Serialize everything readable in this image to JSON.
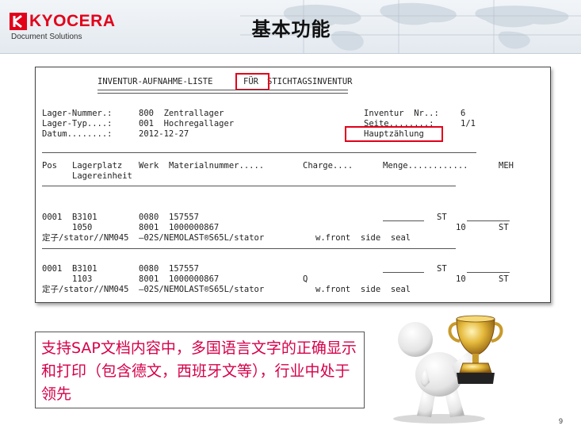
{
  "brand": {
    "name": "KYOCERA",
    "subtitle": "Document Solutions",
    "accent_color": "#e2001a"
  },
  "slide": {
    "title": "基本功能",
    "page_number": "9"
  },
  "printout": {
    "heading_left": "INVENTUR-AUFNAHME-LISTE",
    "heading_fur": "FÜR",
    "heading_right": "STICHTAGSINVENTUR",
    "lager_nummer_label": "Lager-Nummer.:",
    "lager_nummer_value": "800  Zentrallager",
    "lager_typ_label": "Lager-Typ....:",
    "lager_typ_value": "001  Hochregallager",
    "datum_label": "Datum........:",
    "datum_value": "2012-12-27",
    "inventur_label": "Inventur  Nr..:",
    "inventur_value": "6",
    "seite_label": "Seite........:",
    "seite_value": "1/1",
    "hauptzahlung": "Hauptzählung",
    "columns": {
      "pos": "Pos",
      "lagerplatz": "Lagerplatz",
      "lagereinheit": "Lagereinheit",
      "werk": "Werk",
      "materialnummer": "Materialnummer.....",
      "charge": "Charge....",
      "menge": "Menge............",
      "meh": "MEH"
    },
    "rows": [
      {
        "pos": "0001",
        "lagerplatz": "B3101",
        "werk": "0080",
        "material": "157557",
        "lagereinheit": "1050",
        "werk2": "8001",
        "material2": "1000000867",
        "charge": "",
        "st1": "ST",
        "qty": "10",
        "st2": "ST",
        "desc": "定子/stator//NM045  —02S/NEMOLAST®S65L/stator",
        "desc_right": "w.front  side  seal"
      },
      {
        "pos": "0001",
        "lagerplatz": "B3101",
        "werk": "0080",
        "material": "157557",
        "lagereinheit": "1103",
        "werk2": "8001",
        "material2": "1000000867",
        "charge": "Q",
        "st1": "ST",
        "qty": "10",
        "st2": "ST",
        "desc": "定子/stator//NM045  —02S/NEMOLAST®S65L/stator",
        "desc_right": "w.front  side  seal"
      }
    ]
  },
  "info_box": {
    "text": "支持SAP文档内容中，多国语言文字的正确显示和打印（包含德文，西班牙文等），行业中处于领先"
  },
  "trophy_icon": "trophy-figure-icon"
}
